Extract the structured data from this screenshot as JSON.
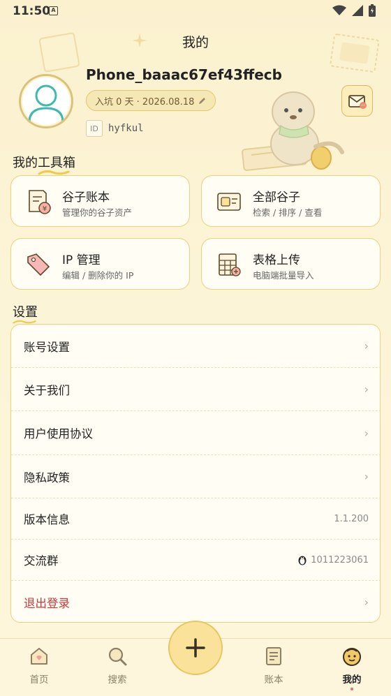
{
  "status": {
    "time": "11:50",
    "badge": "A"
  },
  "page_title": "我的",
  "profile": {
    "username": "Phone_baaac67ef43ffecb",
    "join_text": "入坑 0 天 · 2026.08.18",
    "id_tag": "ID",
    "id_value": "hyfkul"
  },
  "toolbox": {
    "title": "我的工具箱",
    "items": [
      {
        "title": "谷子账本",
        "subtitle": "管理你的谷子资产",
        "icon": "receipt-yen-icon"
      },
      {
        "title": "全部谷子",
        "subtitle": "检索 / 排序 / 查看",
        "icon": "card-list-icon"
      },
      {
        "title": "IP 管理",
        "subtitle": "编辑 / 删除你的 IP",
        "icon": "tag-icon"
      },
      {
        "title": "表格上传",
        "subtitle": "电脑端批量导入",
        "icon": "spreadsheet-upload-icon"
      }
    ]
  },
  "settings": {
    "title": "设置",
    "items": [
      {
        "label": "账号设置",
        "value": "",
        "chevron": "›"
      },
      {
        "label": "关于我们",
        "value": "",
        "chevron": "›"
      },
      {
        "label": "用户使用协议",
        "value": "",
        "chevron": "›"
      },
      {
        "label": "隐私政策",
        "value": "",
        "chevron": "›"
      },
      {
        "label": "版本信息",
        "value": "1.1.200",
        "chevron": ""
      },
      {
        "label": "交流群",
        "value": "1011223061",
        "chevron": ""
      },
      {
        "label": "退出登录",
        "value": "",
        "chevron": "›"
      }
    ]
  },
  "tabbar": {
    "items": [
      {
        "label": "首页",
        "icon": "home-icon"
      },
      {
        "label": "搜索",
        "icon": "search-icon"
      },
      {
        "label": "账本",
        "icon": "ledger-icon"
      },
      {
        "label": "我的",
        "icon": "smiley-face-icon"
      }
    ],
    "add_icon": "plus-icon"
  },
  "colors": {
    "background": "#fbf1cf",
    "card_border": "#ecd27b",
    "accent": "#fbe29a",
    "danger": "#c63a3a"
  }
}
